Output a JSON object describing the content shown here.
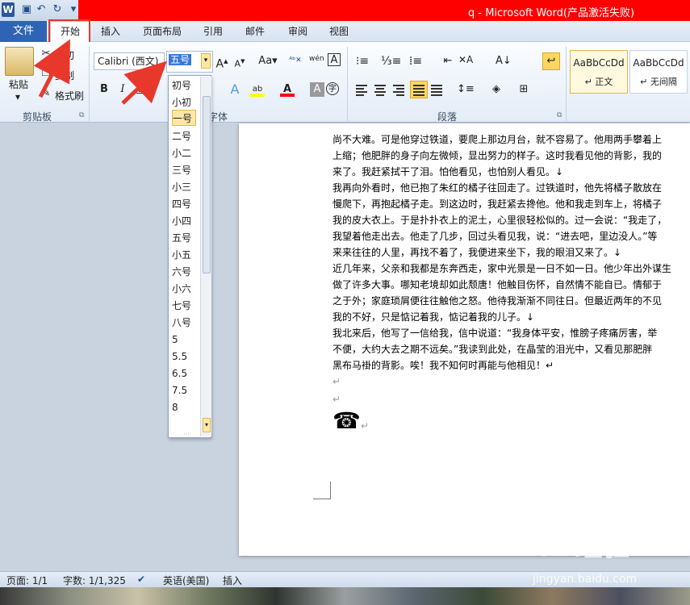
{
  "window": {
    "title": "q - Microsoft Word(产品激活失败)"
  },
  "tabs": {
    "file": "文件",
    "home": "开始",
    "insert": "插入",
    "layout": "页面布局",
    "references": "引用",
    "mailings": "邮件",
    "review": "审阅",
    "view": "视图"
  },
  "clipboard": {
    "paste": "粘贴",
    "cut": "剪切",
    "copy": "复制",
    "format_painter": "格式刷",
    "group_label": "剪贴板"
  },
  "font": {
    "name": "Calibri (西文)",
    "size": "五号",
    "group_label": "字体",
    "bold": "B",
    "italic": "I",
    "underline": "U",
    "grow": "A",
    "shrink": "A",
    "case": "Aa",
    "clear": "A",
    "color_a": "A",
    "circle_char": "字",
    "phonetic": "wén"
  },
  "paragraph": {
    "group_label": "段落"
  },
  "styles": [
    {
      "sample": "AaBbCcDd",
      "name": "↵ 正文"
    },
    {
      "sample": "AaBbCcDd",
      "name": "↵ 无间隔"
    }
  ],
  "font_size_list": [
    "初号",
    "小初",
    "一号",
    "二号",
    "小二",
    "三号",
    "小三",
    "四号",
    "小四",
    "五号",
    "小五",
    "六号",
    "小六",
    "七号",
    "八号",
    "5",
    "5.5",
    "6.5",
    "7.5",
    "8"
  ],
  "font_size_selected": "一号",
  "document": {
    "lines": [
      "尚不大难。可是他穿过铁道，要爬上那边月台，就不容易了。他用两手攀着上",
      "上缩；他肥胖的身子向左微倾，显出努力的样子。这时我看见他的背影，我的",
      "来了。我赶紧拭干了泪。怕他看见，也怕别人看见。↓",
      "我再向外看时，他已抱了朱红的橘子往回走了。过铁道时，他先将橘子散放在",
      "慢爬下，再抱起橘子走。到这边时，我赶紧去搀他。他和我走到车上，将橘子",
      "我的皮大衣上。于是扑扑衣上的泥土，心里很轻松似的。过一会说：“我走了，",
      "我望着他走出去。他走了几步，回过头看见我，说：“进去吧，里边没人。”等",
      "来来往往的人里，再找不着了，我便进来坐下，我的眼泪又来了。↓",
      "近几年来，父亲和我都是东奔西走，家中光景是一日不如一日。他少年出外谋生",
      "做了许多大事。哪知老境却如此颓唐！他触目伤怀，自然情不能自已。情郁于",
      "之于外；家庭琐屑便往往触他之怒。他待我渐渐不同往日。但最近两年的不见",
      "我的不好，只是惦记着我，惦记着我的儿子。↓",
      "我北来后，他写了一信给我，信中说道：“我身体平安，惟膀子疼痛厉害，举",
      "不便，大约大去之期不远矣。”我读到此处，在晶莹的泪光中，又看见那肥胖",
      "黑布马褂的背影。唉！我不知何时再能与他相见！↵"
    ],
    "empty_mark": "↵",
    "phone_glyph": "☎"
  },
  "status": {
    "page": "页面: 1/1",
    "words": "字数: 1/1,325",
    "language": "英语(美国)",
    "insert_mode": "插入"
  },
  "watermark": {
    "brand": "Bai 经验",
    "url": "jingyan.baidu.com"
  },
  "colors": {
    "highlight_red": "#e8382c",
    "title_red": "#ff0000",
    "file_tab_blue": "#2f64b5"
  }
}
